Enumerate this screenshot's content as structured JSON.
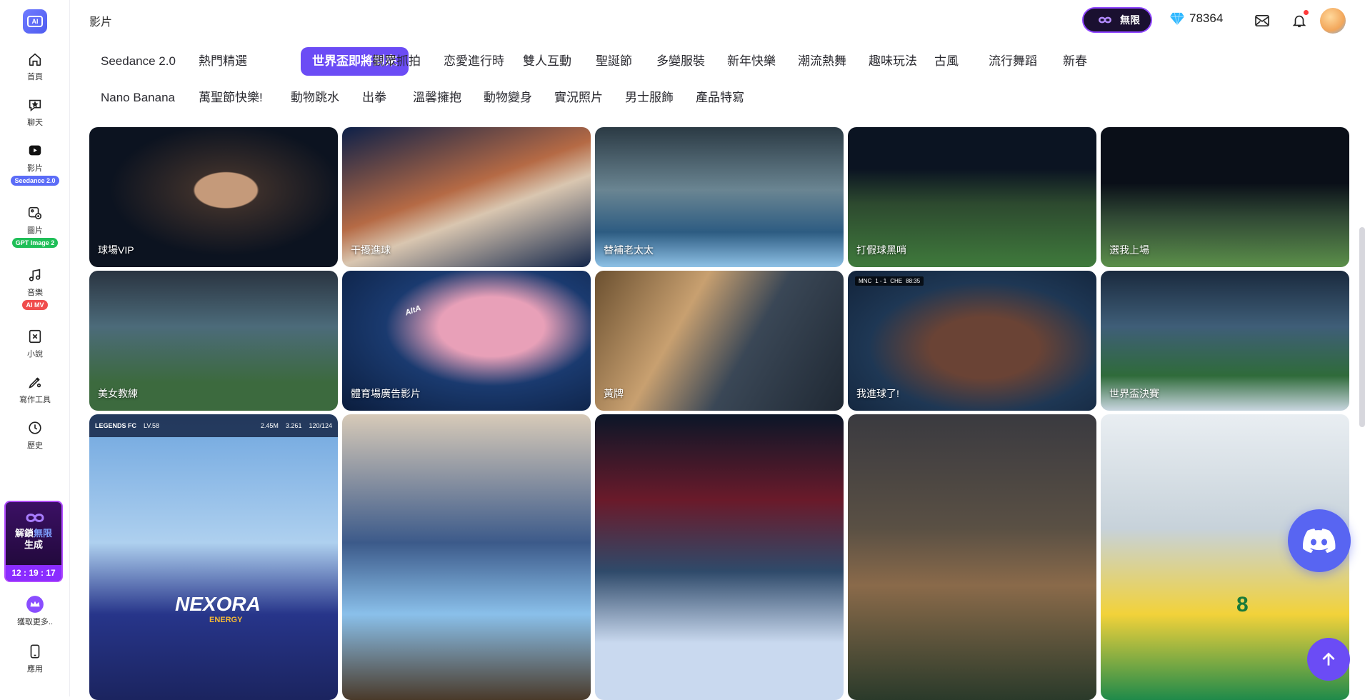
{
  "sidebar": {
    "logo": "ai-logo-icon",
    "items": [
      {
        "label": "首頁",
        "icon": "home-icon"
      },
      {
        "label": "聊天",
        "icon": "chat-icon"
      },
      {
        "label": "影片",
        "icon": "video-icon",
        "tag": "Seedance 2.0"
      },
      {
        "label": "圖片",
        "icon": "image-icon",
        "tag": "GPT Image 2"
      },
      {
        "label": "音樂",
        "icon": "music-icon",
        "tag": "AI MV"
      },
      {
        "label": "小說",
        "icon": "novel-icon"
      },
      {
        "label": "寫作工具",
        "icon": "pen-icon"
      },
      {
        "label": "歷史",
        "icon": "history-icon"
      },
      {
        "label": "獲取更多..",
        "icon": "crown-icon"
      },
      {
        "label": "應用",
        "icon": "phone-icon"
      }
    ],
    "promo": {
      "line1_a": "解鎖",
      "line1_b": "無限",
      "line2": "生成",
      "timer": "12 : 19 : 17"
    }
  },
  "header": {
    "title": "影片",
    "unlimited_label": "無限",
    "gems": "78364"
  },
  "tabs": {
    "row1": [
      "Seedance 2.0",
      "熱門精選",
      "世界盃即將到來",
      "觀眾抓拍",
      "恋愛進行時",
      "雙人互動",
      "聖誕節",
      "多變服裝",
      "新年快樂",
      "潮流熱舞",
      "趣味玩法",
      "古風",
      "流行舞蹈",
      "新春"
    ],
    "row2": [
      "Nano Banana",
      "萬聖節快樂!",
      "動物跳水",
      "出拳",
      "溫馨擁抱",
      "動物變身",
      "實況照片",
      "男士服飾",
      "產品特寫"
    ],
    "active": "世界盃即將到來"
  },
  "cards": {
    "row1": [
      "球場VIP",
      "干擾進球",
      "替補老太太",
      "打假球黑哨",
      "選我上場"
    ],
    "row2": [
      "美女教練",
      "體育場廣告影片",
      "黃牌",
      "我進球了!",
      "世界盃決賽"
    ],
    "row3": [
      "",
      "",
      "",
      "",
      ""
    ]
  },
  "overlays": {
    "game_hud": {
      "team": "LEGENDS FC",
      "level": "LV.58",
      "coins": "2.45M",
      "gems": "3.261",
      "stamina": "120/124"
    },
    "score_hud": {
      "home": "MNC",
      "score": "1 - 1",
      "away": "CHE",
      "clock": "88:35"
    },
    "jersey_text": "NEXORA",
    "jersey_sub": "ENERGY",
    "brazil_number": "8",
    "can_text": "AltA"
  },
  "colors": {
    "accent": "#6b4cf5",
    "discord": "#5865f2",
    "promo_border": "#b14cff"
  },
  "widgets": {
    "discord": "discord-icon",
    "back_to_top": "arrow-up-icon"
  }
}
